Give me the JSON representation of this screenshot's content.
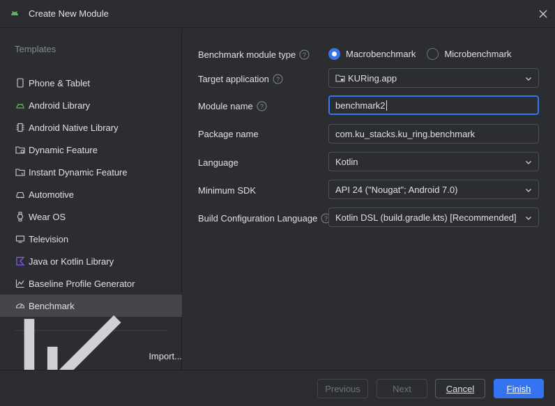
{
  "window": {
    "title": "Create New Module"
  },
  "sidebar": {
    "section_label": "Templates",
    "items": [
      {
        "label": "Phone & Tablet",
        "icon": "phone-icon"
      },
      {
        "label": "Android Library",
        "icon": "android-icon"
      },
      {
        "label": "Android Native Library",
        "icon": "native-library-icon"
      },
      {
        "label": "Dynamic Feature",
        "icon": "dynamic-feature-icon"
      },
      {
        "label": "Instant Dynamic Feature",
        "icon": "instant-feature-icon"
      },
      {
        "label": "Automotive",
        "icon": "car-icon"
      },
      {
        "label": "Wear OS",
        "icon": "watch-icon"
      },
      {
        "label": "Television",
        "icon": "tv-icon"
      },
      {
        "label": "Java or Kotlin Library",
        "icon": "kotlin-icon"
      },
      {
        "label": "Baseline Profile Generator",
        "icon": "profile-chart-icon"
      },
      {
        "label": "Benchmark",
        "icon": "gauge-icon",
        "selected": true
      }
    ],
    "import_label": "Import..."
  },
  "form": {
    "benchmark_type": {
      "label": "Benchmark module type",
      "options": [
        "Macrobenchmark",
        "Microbenchmark"
      ],
      "selected": "Macrobenchmark"
    },
    "target_application": {
      "label": "Target application",
      "value": "KURing.app"
    },
    "module_name": {
      "label": "Module name",
      "value": "benchmark2"
    },
    "package_name": {
      "label": "Package name",
      "value": "com.ku_stacks.ku_ring.benchmark"
    },
    "language": {
      "label": "Language",
      "value": "Kotlin"
    },
    "minimum_sdk": {
      "label": "Minimum SDK",
      "value": "API 24 (\"Nougat\"; Android 7.0)"
    },
    "build_config_language": {
      "label": "Build Configuration Language",
      "value": "Kotlin DSL (build.gradle.kts) [Recommended]"
    }
  },
  "footer": {
    "previous": "Previous",
    "next": "Next",
    "cancel": "Cancel",
    "finish": "Finish"
  },
  "colors": {
    "background": "#2b2d30",
    "selected_item": "#43454a",
    "accent": "#3574f0",
    "android_green": "#5fb85a",
    "kotlin_purple": "#8b5cf6",
    "text": "#dfe1e5",
    "muted_text": "#868a91"
  }
}
